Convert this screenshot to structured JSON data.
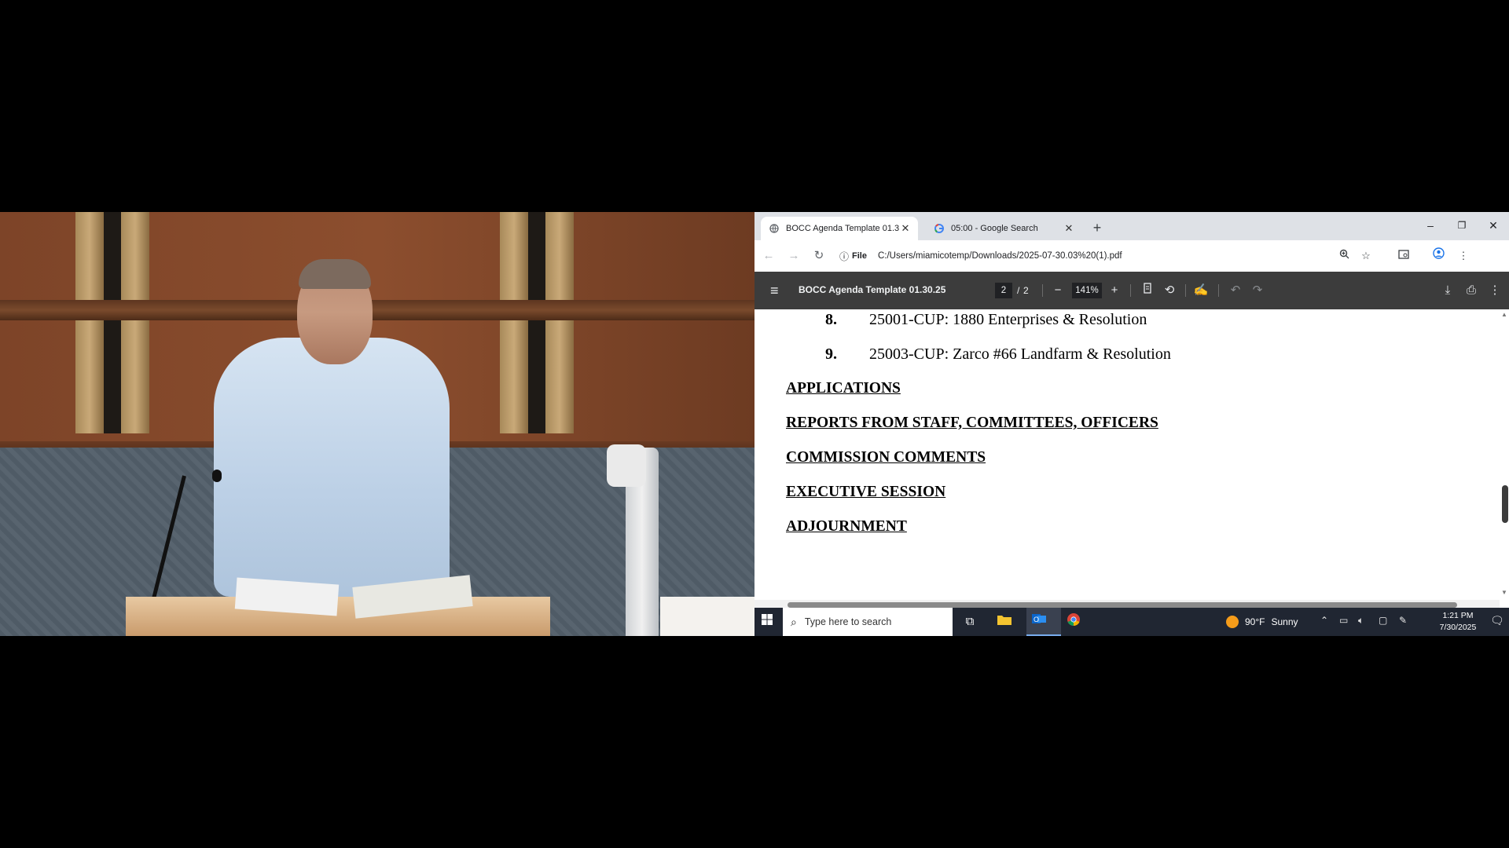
{
  "browser": {
    "tabs": [
      {
        "title": "BOCC Agenda Template 01.30.",
        "active": true,
        "icon": "globe-icon"
      },
      {
        "title": "05:00 - Google Search",
        "active": false,
        "icon": "google-g-icon"
      }
    ],
    "new_tab_icon": "plus-icon",
    "window_controls": {
      "minimize": "–",
      "restore": "❐",
      "close": "✕"
    },
    "address": {
      "info_label": "File",
      "url": "C:/Users/miamicotemp/Downloads/2025-07-30.03%20(1).pdf"
    }
  },
  "pdf_toolbar": {
    "title": "BOCC Agenda Template 01.30.25",
    "current_page": "2",
    "separator": "/",
    "total_pages": "2",
    "zoom": "141%"
  },
  "pdf_content": {
    "items": [
      {
        "number": "8.",
        "text": "25001-CUP: 1880 Enterprises & Resolution"
      },
      {
        "number": "9.",
        "text": "25003-CUP: Zarco #66 Landfarm & Resolution"
      }
    ],
    "headings": [
      "APPLICATIONS",
      "REPORTS FROM STAFF, COMMITTEES, OFFICERS",
      "COMMISSION COMMENTS",
      "EXECUTIVE SESSION",
      "ADJOURNMENT"
    ]
  },
  "taskbar": {
    "search_placeholder": "Type here to search",
    "weather": {
      "temperature": "90°F",
      "condition": "Sunny"
    },
    "clock": {
      "time": "1:21 PM",
      "date": "7/30/2025"
    }
  },
  "colors": {
    "pdf_toolbar_bg": "#3c3c3c",
    "tabbar_bg": "#dee1e6",
    "taskbar_bg": "#202632",
    "active_taskbar_accent": "#79aef0"
  }
}
